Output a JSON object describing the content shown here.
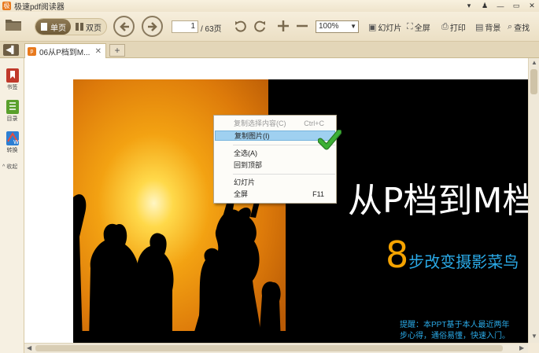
{
  "app": {
    "title": "极速pdf阅读器",
    "logo_glyph": "极"
  },
  "window_controls": [
    "▾",
    "♟",
    "—",
    "▭",
    "✕"
  ],
  "toolbar": {
    "single_page_label": "单页",
    "double_page_label": "双页",
    "page_current": "1",
    "page_total": "/ 63页",
    "zoom_value": "100%",
    "slideshow_label": "幻灯片",
    "fullscreen_label": "全屏",
    "print_label": "打印",
    "background_label": "背景",
    "search_label": "查找"
  },
  "tabs": [
    {
      "label": "06从P档到M...",
      "icon_glyph": "p"
    }
  ],
  "new_tab_label": "+",
  "nav_toggle_label": "◀▌",
  "sidebar": {
    "items": [
      {
        "label": "书签",
        "icon": "bookmark-icon",
        "color": "#c0392b"
      },
      {
        "label": "目录",
        "icon": "toc-icon",
        "color": "#5aa02c"
      },
      {
        "label": "转换",
        "icon": "convert-icon",
        "color": "#2d7fd3"
      }
    ],
    "collapse_label": "^ 收起"
  },
  "slide": {
    "title": "从P档到M档",
    "number": "8",
    "subtitle": "步改变摄影菜鸟",
    "note_line1": "提醒：本PPT基于本人最近两年",
    "note_line2": "步心得，通俗易懂，快速入门。"
  },
  "context_menu": {
    "items": [
      {
        "label": "复制选择内容(C)",
        "shortcut": "Ctrl+C",
        "disabled": true,
        "hover": false
      },
      {
        "label": "复制图片(I)",
        "shortcut": "",
        "disabled": false,
        "hover": true
      },
      {
        "label": "全选(A)",
        "shortcut": "",
        "disabled": false,
        "hover": false
      },
      {
        "label": "回到顶部",
        "shortcut": "",
        "disabled": false,
        "hover": false
      },
      {
        "label": "幻灯片",
        "shortcut": "",
        "disabled": false,
        "hover": false
      },
      {
        "label": "全屏",
        "shortcut": "F11",
        "disabled": false,
        "hover": false
      }
    ]
  },
  "colors": {
    "accent_orange": "#e87a1e",
    "slide_blue": "#2aa9e6",
    "slide_number_orange": "#f5a300",
    "check_green": "#3cb034"
  }
}
